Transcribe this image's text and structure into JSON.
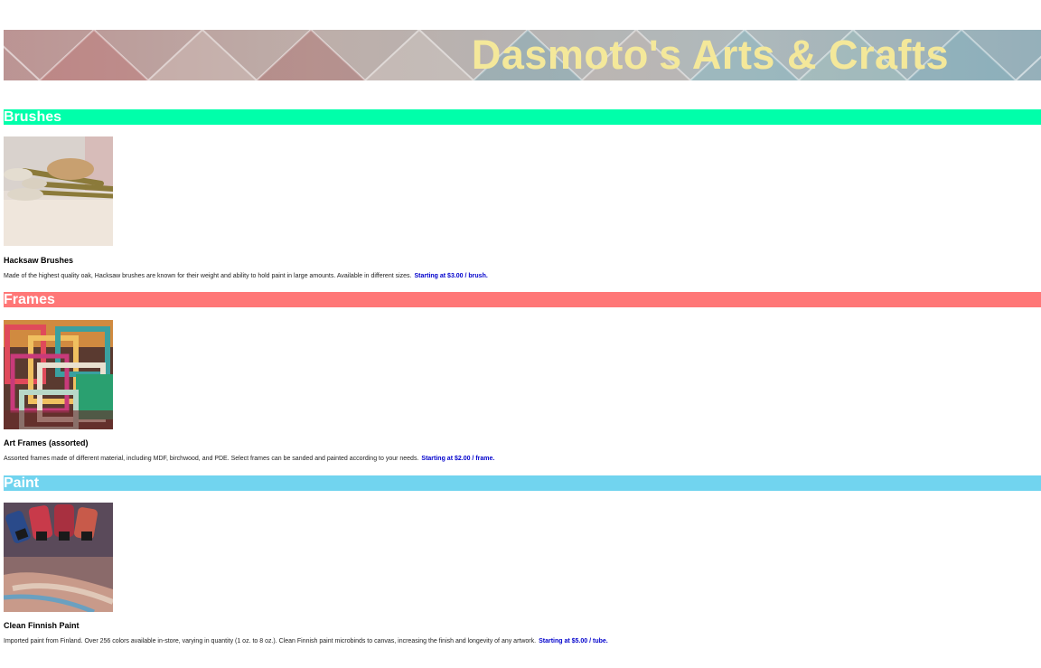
{
  "header": {
    "title": "Dasmoto's Arts & Crafts"
  },
  "colors": {
    "title_text": "#f4e89a",
    "brushes_bar": "#00ffaa",
    "frames_bar": "#ff7777",
    "paint_bar": "#71d4ef",
    "price_text": "#0000cc"
  },
  "sections": [
    {
      "heading": "Brushes",
      "image_icon": "brushes-photo",
      "item_name": "Hacksaw Brushes",
      "description": "Made of the highest quality oak, Hacksaw brushes are known for their weight and ability to hold paint in large amounts. Available in different sizes.",
      "price": "Starting at $3.00 / brush."
    },
    {
      "heading": "Frames",
      "image_icon": "frames-photo",
      "item_name": "Art Frames (assorted)",
      "description": "Assorted frames made of different material, including MDF, birchwood, and PDE. Select frames can be sanded and painted according to your needs.",
      "price": "Starting at $2.00 / frame."
    },
    {
      "heading": "Paint",
      "image_icon": "paint-tubes-photo",
      "item_name": "Clean Finnish Paint",
      "description": "Imported paint from Finland. Over 256 colors available in-store, varying in quantity (1 oz. to 8 oz.). Clean Finnish paint microbinds to canvas, increasing the finish and longevity of any artwork.",
      "price": "Starting at $5.00 / tube."
    }
  ]
}
